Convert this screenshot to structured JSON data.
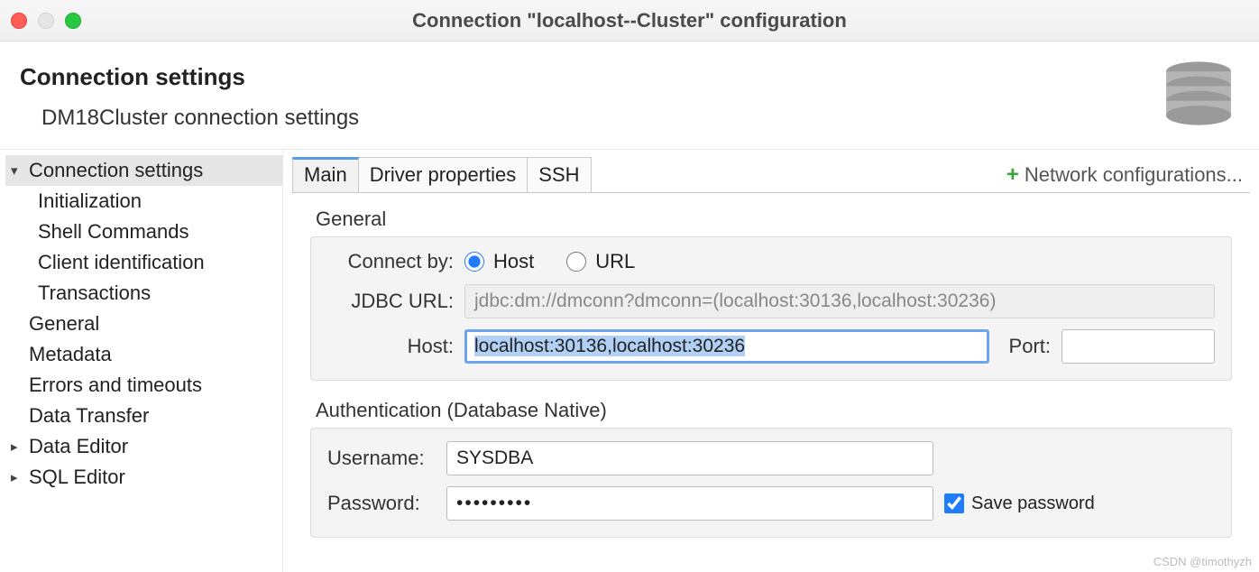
{
  "titlebar": {
    "title": "Connection \"localhost--Cluster\" configuration"
  },
  "header": {
    "title": "Connection settings",
    "subtitle": "DM18Cluster connection settings"
  },
  "sidebar": {
    "items": [
      {
        "label": "Connection settings",
        "expandable": true,
        "expanded": true,
        "selected": true,
        "indent": 0
      },
      {
        "label": "Initialization",
        "indent": 1
      },
      {
        "label": "Shell Commands",
        "indent": 1
      },
      {
        "label": "Client identification",
        "indent": 1
      },
      {
        "label": "Transactions",
        "indent": 1
      },
      {
        "label": "General",
        "indent": 0
      },
      {
        "label": "Metadata",
        "indent": 0
      },
      {
        "label": "Errors and timeouts",
        "indent": 0
      },
      {
        "label": "Data Transfer",
        "indent": 0
      },
      {
        "label": "Data Editor",
        "expandable": true,
        "expanded": false,
        "indent": 0
      },
      {
        "label": "SQL Editor",
        "expandable": true,
        "expanded": false,
        "indent": 0
      }
    ]
  },
  "tabs": {
    "items": [
      "Main",
      "Driver properties",
      "SSH"
    ],
    "active": 0,
    "network_config": "Network configurations..."
  },
  "form": {
    "general": {
      "section": "General",
      "connect_by_label": "Connect by:",
      "host_radio": "Host",
      "url_radio": "URL",
      "jdbc_label": "JDBC URL:",
      "jdbc_value": "jdbc:dm://dmconn?dmconn=(localhost:30136,localhost:30236)",
      "host_label": "Host:",
      "host_value": "localhost:30136,localhost:30236",
      "port_label": "Port:",
      "port_value": ""
    },
    "auth": {
      "section": "Authentication (Database Native)",
      "username_label": "Username:",
      "username_value": "SYSDBA",
      "password_label": "Password:",
      "password_value": "•••••••••",
      "save_password": "Save password"
    }
  },
  "watermark": "CSDN @timothyzh"
}
